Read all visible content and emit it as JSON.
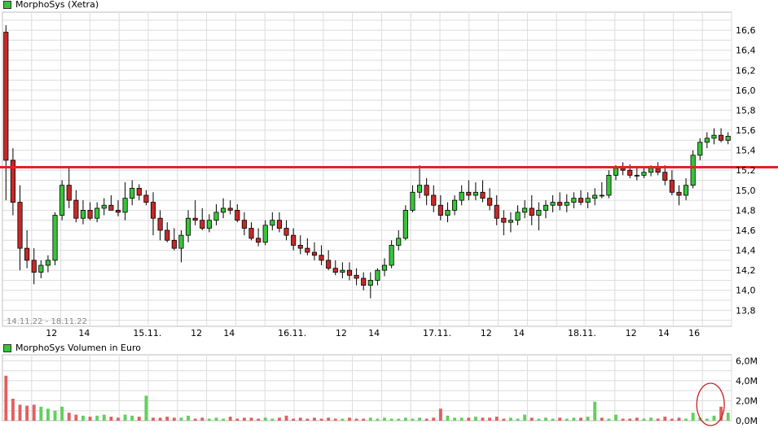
{
  "chart_data": [
    {
      "type": "candlestick",
      "title": "MorphoSys (Xetra)",
      "date_range": "14.11.22 - 18.11.22",
      "ylim": [
        13.64,
        16.78
      ],
      "y_ticks": [
        "16,6",
        "16,4",
        "16,2",
        "16,0",
        "15,8",
        "15,6",
        "15,4",
        "15,2",
        "15,0",
        "14,8",
        "14,6",
        "14,4",
        "14,2",
        "14,0",
        "13,8"
      ],
      "y_tick_values": [
        16.6,
        16.4,
        16.2,
        16.0,
        15.8,
        15.6,
        15.4,
        15.2,
        15.0,
        14.8,
        14.6,
        14.4,
        14.2,
        14.0,
        13.8
      ],
      "x_ticks": [
        "12",
        "14",
        "15.11.",
        "12",
        "14",
        "16.11.",
        "12",
        "14",
        "17.11.",
        "12",
        "14",
        "18.11.",
        "12",
        "14",
        "16"
      ],
      "x_tick_values": [
        7.0,
        11.67,
        20.67,
        27.67,
        32.33,
        41.33,
        48.33,
        53.0,
        62.0,
        69.0,
        73.67,
        82.67,
        89.67,
        94.33,
        98.67
      ],
      "x_min": 0,
      "x_max": 104,
      "grid": true,
      "resistance_line": 15.23,
      "series": [
        {
          "x": [
            0.5,
            1.5,
            2.5,
            3.5,
            4.5,
            5.5,
            6.5,
            7.5,
            8.5,
            9.5,
            10.5,
            11.5,
            12.5,
            13.5,
            14.5,
            15.5,
            16.5,
            17.5,
            18.5,
            19.5,
            20.5,
            21.5,
            22.5,
            23.5,
            24.5,
            25.5,
            26.5,
            27.5,
            28.5,
            29.5,
            30.5,
            31.5,
            32.5,
            33.5,
            34.5,
            35.5,
            36.5,
            37.5,
            38.5,
            39.5,
            40.5,
            41.5,
            42.5,
            43.5,
            44.5,
            45.5,
            46.5,
            47.5,
            48.5,
            49.5,
            50.5,
            51.5,
            52.5,
            53.5,
            54.5,
            55.5,
            56.5,
            57.5,
            58.5,
            59.5,
            60.5,
            61.5,
            62.5,
            63.5,
            64.5,
            65.5,
            66.5,
            67.5,
            68.5,
            69.5,
            70.5,
            71.5,
            72.5,
            73.5,
            74.5,
            75.5,
            76.5,
            77.5,
            78.5,
            79.5,
            80.5,
            81.5,
            82.5,
            83.5,
            84.5,
            85.5,
            86.5,
            87.5,
            88.5,
            89.5,
            90.5,
            91.5,
            92.5,
            93.5,
            94.5,
            95.5,
            96.5,
            97.5,
            98.5,
            99.5,
            100.5,
            101.5,
            102.5,
            103.5
          ],
          "open": [
            16.58,
            15.3,
            14.88,
            14.42,
            14.3,
            14.18,
            14.25,
            14.3,
            14.75,
            15.05,
            14.9,
            14.72,
            14.8,
            14.72,
            14.82,
            14.85,
            14.8,
            14.78,
            14.92,
            15.02,
            14.95,
            14.88,
            14.72,
            14.6,
            14.5,
            14.42,
            14.55,
            14.72,
            14.7,
            14.62,
            14.7,
            14.78,
            14.82,
            14.8,
            14.7,
            14.62,
            14.52,
            14.48,
            14.65,
            14.7,
            14.62,
            14.55,
            14.45,
            14.42,
            14.38,
            14.35,
            14.3,
            14.22,
            14.18,
            14.2,
            14.15,
            14.12,
            14.05,
            14.1,
            14.2,
            14.25,
            14.45,
            14.52,
            14.8,
            14.98,
            15.05,
            14.95,
            14.85,
            14.75,
            14.8,
            14.9,
            14.98,
            14.95,
            14.98,
            14.92,
            14.85,
            14.72,
            14.68,
            14.7,
            14.78,
            14.82,
            14.75,
            14.8,
            14.85,
            14.88,
            14.85,
            14.88,
            14.92,
            14.88,
            14.92,
            14.95,
            14.95,
            15.15,
            15.22,
            15.2,
            15.15,
            15.15,
            15.18,
            15.22,
            15.18,
            15.1,
            14.98,
            14.95,
            15.05,
            15.35,
            15.48,
            15.52,
            15.55,
            15.5
          ],
          "high": [
            16.65,
            15.42,
            15.05,
            14.6,
            14.42,
            14.3,
            14.35,
            14.78,
            15.1,
            15.22,
            15.0,
            14.9,
            14.88,
            14.88,
            14.92,
            14.95,
            14.9,
            15.08,
            15.1,
            15.06,
            15.0,
            14.98,
            14.8,
            14.68,
            14.62,
            14.6,
            14.8,
            14.9,
            14.82,
            14.76,
            14.86,
            14.92,
            14.9,
            14.86,
            14.78,
            14.68,
            14.62,
            14.7,
            14.78,
            14.78,
            14.7,
            14.62,
            14.55,
            14.52,
            14.48,
            14.45,
            14.4,
            14.3,
            14.28,
            14.28,
            14.22,
            14.18,
            14.18,
            14.22,
            14.32,
            14.5,
            14.6,
            14.85,
            15.05,
            15.25,
            15.12,
            15.05,
            14.95,
            14.88,
            14.95,
            15.05,
            15.1,
            15.08,
            15.1,
            15.02,
            14.95,
            14.8,
            14.78,
            14.85,
            14.9,
            14.95,
            14.88,
            14.9,
            14.95,
            14.98,
            14.96,
            14.98,
            15.0,
            14.98,
            15.02,
            15.08,
            15.2,
            15.25,
            15.28,
            15.26,
            15.22,
            15.22,
            15.25,
            15.28,
            15.25,
            15.2,
            15.05,
            15.12,
            15.4,
            15.52,
            15.58,
            15.62,
            15.62,
            15.58
          ],
          "low": [
            14.9,
            14.75,
            14.2,
            14.22,
            14.06,
            14.12,
            14.18,
            14.25,
            14.7,
            14.82,
            14.68,
            14.66,
            14.7,
            14.68,
            14.75,
            14.8,
            14.74,
            14.7,
            14.85,
            14.9,
            14.85,
            14.55,
            14.5,
            14.48,
            14.4,
            14.28,
            14.48,
            14.65,
            14.6,
            14.58,
            14.65,
            14.72,
            14.76,
            14.68,
            14.55,
            14.5,
            14.44,
            14.45,
            14.6,
            14.58,
            14.5,
            14.4,
            14.36,
            14.35,
            14.3,
            14.25,
            14.2,
            14.15,
            14.12,
            14.1,
            14.05,
            14.0,
            13.92,
            14.05,
            14.14,
            14.22,
            14.4,
            14.5,
            14.78,
            14.92,
            14.85,
            14.78,
            14.7,
            14.68,
            14.75,
            14.85,
            14.9,
            14.9,
            14.88,
            14.8,
            14.65,
            14.55,
            14.58,
            14.65,
            14.72,
            14.65,
            14.6,
            14.72,
            14.78,
            14.8,
            14.78,
            14.82,
            14.85,
            14.82,
            14.85,
            14.92,
            14.92,
            15.1,
            15.15,
            15.12,
            15.1,
            15.12,
            15.14,
            15.15,
            15.05,
            14.95,
            14.85,
            14.9,
            15.02,
            15.3,
            15.42,
            15.46,
            15.48,
            15.46
          ],
          "close": [
            15.3,
            14.88,
            14.42,
            14.3,
            14.18,
            14.25,
            14.3,
            14.75,
            15.05,
            14.9,
            14.72,
            14.8,
            14.72,
            14.82,
            14.85,
            14.8,
            14.78,
            14.92,
            15.02,
            14.95,
            14.88,
            14.72,
            14.6,
            14.5,
            14.42,
            14.55,
            14.72,
            14.7,
            14.62,
            14.7,
            14.78,
            14.82,
            14.8,
            14.7,
            14.62,
            14.52,
            14.48,
            14.65,
            14.7,
            14.62,
            14.55,
            14.45,
            14.42,
            14.38,
            14.35,
            14.3,
            14.22,
            14.18,
            14.2,
            14.15,
            14.12,
            14.05,
            14.1,
            14.2,
            14.25,
            14.45,
            14.52,
            14.8,
            14.98,
            15.05,
            14.95,
            14.85,
            14.75,
            14.8,
            14.9,
            14.98,
            14.95,
            14.98,
            14.92,
            14.85,
            14.72,
            14.68,
            14.7,
            14.78,
            14.82,
            14.75,
            14.8,
            14.85,
            14.88,
            14.85,
            14.88,
            14.92,
            14.88,
            14.92,
            14.95,
            14.95,
            15.15,
            15.22,
            15.2,
            15.15,
            15.15,
            15.18,
            15.22,
            15.18,
            15.1,
            14.98,
            14.95,
            15.05,
            15.35,
            15.48,
            15.52,
            15.55,
            15.5,
            15.54
          ]
        }
      ]
    },
    {
      "type": "bar",
      "title": "MorphoSys Volumen in Euro",
      "ylim": [
        0,
        6.6
      ],
      "y_ticks": [
        "6,0M",
        "4,0M",
        "2,0M",
        "0,0M"
      ],
      "y_tick_values": [
        6.0,
        4.0,
        2.0,
        0.0
      ],
      "x_ticks": [
        "12",
        "14",
        "15.11.",
        "12",
        "14",
        "16.11.",
        "12",
        "14",
        "17.11.",
        "12",
        "14",
        "18.11.",
        "12",
        "14",
        "16"
      ],
      "x_tick_values": [
        7.0,
        11.67,
        20.67,
        27.67,
        32.33,
        41.33,
        48.33,
        53.0,
        62.0,
        69.0,
        73.67,
        82.67,
        89.67,
        94.33,
        98.67
      ],
      "x_min": 0,
      "x_max": 104,
      "grid": true,
      "highlight_ellipse_x": [
        99.5,
        102.5
      ],
      "series": [
        {
          "x": [
            0.5,
            1.5,
            2.5,
            3.5,
            4.5,
            5.5,
            6.5,
            7.5,
            8.5,
            9.5,
            10.5,
            11.5,
            12.5,
            13.5,
            14.5,
            15.5,
            16.5,
            17.5,
            18.5,
            19.5,
            20.5,
            21.5,
            22.5,
            23.5,
            24.5,
            25.5,
            26.5,
            27.5,
            28.5,
            29.5,
            30.5,
            31.5,
            32.5,
            33.5,
            34.5,
            35.5,
            36.5,
            37.5,
            38.5,
            39.5,
            40.5,
            41.5,
            42.5,
            43.5,
            44.5,
            45.5,
            46.5,
            47.5,
            48.5,
            49.5,
            50.5,
            51.5,
            52.5,
            53.5,
            54.5,
            55.5,
            56.5,
            57.5,
            58.5,
            59.5,
            60.5,
            61.5,
            62.5,
            63.5,
            64.5,
            65.5,
            66.5,
            67.5,
            68.5,
            69.5,
            70.5,
            71.5,
            72.5,
            73.5,
            74.5,
            75.5,
            76.5,
            77.5,
            78.5,
            79.5,
            80.5,
            81.5,
            82.5,
            83.5,
            84.5,
            85.5,
            86.5,
            87.5,
            88.5,
            89.5,
            90.5,
            91.5,
            92.5,
            93.5,
            94.5,
            95.5,
            96.5,
            97.5,
            98.5,
            99.5,
            100.5,
            101.5,
            102.5,
            103.5
          ],
          "values": [
            4.5,
            2.2,
            1.6,
            1.5,
            1.6,
            1.4,
            1.2,
            1.0,
            1.4,
            0.8,
            0.6,
            0.5,
            0.4,
            0.5,
            0.6,
            0.4,
            0.3,
            0.6,
            0.5,
            0.4,
            2.5,
            0.3,
            0.3,
            0.4,
            0.3,
            0.3,
            0.5,
            0.2,
            0.3,
            0.2,
            0.3,
            0.2,
            0.4,
            0.2,
            0.3,
            0.3,
            0.2,
            0.3,
            0.2,
            0.3,
            0.5,
            0.2,
            0.3,
            0.2,
            0.3,
            0.2,
            0.3,
            0.2,
            0.2,
            0.3,
            0.2,
            0.2,
            0.3,
            0.2,
            0.3,
            0.2,
            0.2,
            0.3,
            0.2,
            0.3,
            0.2,
            0.3,
            1.2,
            0.5,
            0.3,
            0.3,
            0.3,
            0.4,
            0.3,
            0.3,
            0.4,
            0.2,
            0.3,
            0.2,
            0.6,
            0.3,
            0.2,
            0.3,
            0.2,
            0.3,
            0.2,
            0.3,
            0.3,
            0.4,
            1.9,
            0.3,
            0.2,
            0.6,
            0.2,
            0.2,
            0.3,
            0.2,
            0.3,
            0.2,
            0.4,
            0.2,
            0.3,
            0.2,
            0.8,
            0.3,
            0.2,
            0.5,
            1.4,
            0.8
          ],
          "up": [
            false,
            false,
            false,
            false,
            false,
            true,
            true,
            true,
            true,
            false,
            false,
            true,
            false,
            true,
            true,
            false,
            false,
            true,
            true,
            false,
            true,
            false,
            false,
            false,
            false,
            true,
            true,
            false,
            false,
            true,
            true,
            true,
            false,
            false,
            false,
            false,
            false,
            true,
            true,
            false,
            false,
            false,
            false,
            false,
            false,
            false,
            false,
            false,
            true,
            false,
            false,
            false,
            true,
            true,
            true,
            true,
            true,
            true,
            true,
            true,
            false,
            false,
            false,
            true,
            true,
            true,
            false,
            true,
            false,
            false,
            false,
            false,
            true,
            true,
            true,
            false,
            true,
            true,
            true,
            false,
            true,
            true,
            false,
            true,
            true,
            false,
            true,
            true,
            false,
            false,
            false,
            true,
            true,
            false,
            false,
            false,
            false,
            true,
            true,
            true,
            true,
            true,
            false,
            true
          ]
        }
      ]
    }
  ],
  "colors": {
    "up_fill": "#39c43a",
    "down_fill": "#c82828",
    "candle_outline": "#000000",
    "resistance": "#e02424",
    "highlight_ellipse": "#cc2020",
    "grid": "#dcdcdc",
    "volume_up": "#62d05c",
    "volume_down": "#e06060"
  }
}
